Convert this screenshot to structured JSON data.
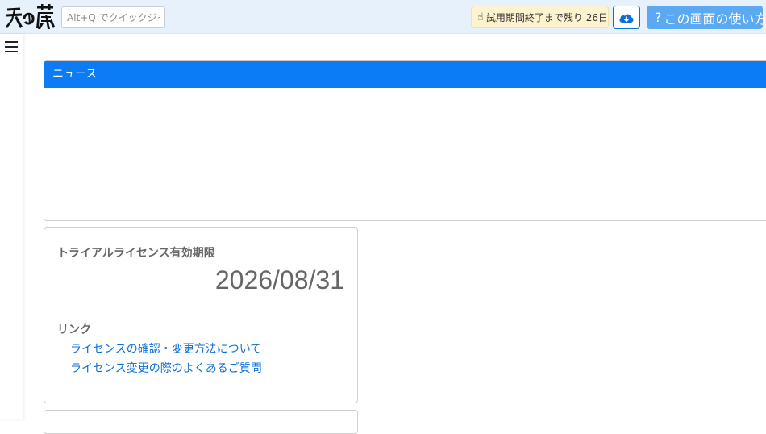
{
  "header": {
    "logo_text": "天の蔵",
    "quick_jump_placeholder": "Alt+Q でクイックジャンプ",
    "trial_badge": "試用期間終了まで残り 26日",
    "help_button": "この画面の使い方",
    "help_button_prefix": "?"
  },
  "news": {
    "title": "ニュース"
  },
  "license": {
    "title": "トライアルライセンス有効期限",
    "expiry_date": "2026/08/31",
    "links_label": "リンク",
    "links": [
      "ライセンスの確認・変更方法について",
      "ライセンス変更の際のよくあるご質問"
    ]
  },
  "colors": {
    "topbar_bg": "#e6f1fb",
    "news_header_bg": "#0b7cf5",
    "help_button_bg": "#5aa9f2",
    "trial_badge_bg": "#fdf3cf",
    "link_color": "#0b6fd6"
  },
  "icons": {
    "trial_badge": "hand-pointer-icon",
    "download": "cloud-download-icon",
    "menu": "hamburger-menu-icon"
  }
}
